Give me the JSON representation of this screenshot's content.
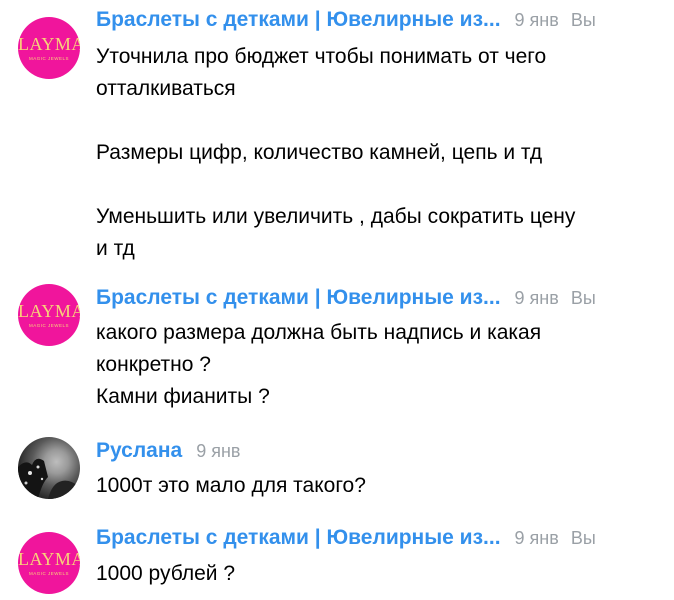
{
  "messages": [
    {
      "avatar": {
        "type": "brand-logo",
        "logo_text": "LAYMA",
        "logo_sub": "MAGIC JEWELS",
        "background": "#f0159c",
        "text_color": "#f7d27a"
      },
      "sender": "Браслеты с детками | Ювелирные из...",
      "date": "9 янв",
      "you": "Вы",
      "text": "Уточнила про бюджет чтобы понимать от чего\nотталкиваться\n\nРазмеры цифр, количество камней, цепь и тд\n\nУменьшить или увеличить , дабы сократить цену\nи тд"
    },
    {
      "avatar": {
        "type": "brand-logo",
        "logo_text": "LAYMA",
        "logo_sub": "MAGIC JEWELS",
        "background": "#f0159c",
        "text_color": "#f7d27a"
      },
      "sender": "Браслеты с детками | Ювелирные из...",
      "date": "9 янв",
      "you": "Вы",
      "text": "какого размера должна быть надпись и какая\nконкретно ?\nКамни фианиты ?"
    },
    {
      "avatar": {
        "type": "photo"
      },
      "sender": "Руслана",
      "date": "9 янв",
      "text": "1000т это мало для такого?"
    },
    {
      "avatar": {
        "type": "brand-logo",
        "logo_text": "LAYMA",
        "logo_sub": "MAGIC JEWELS",
        "background": "#f0159c",
        "text_color": "#f7d27a"
      },
      "sender": "Браслеты с детками | Ювелирные из...",
      "date": "9 янв",
      "you": "Вы",
      "text": "1000 рублей ?"
    }
  ],
  "colors": {
    "sender_name": "#3390ec",
    "meta_text": "#9aa0a6",
    "message_text": "#000000"
  }
}
